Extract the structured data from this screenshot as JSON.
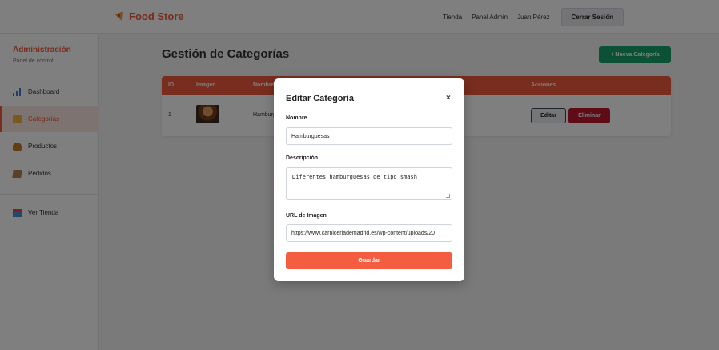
{
  "navbar": {
    "brand": "Food Store",
    "links": [
      "Tienda",
      "Panel Admin",
      "Juan Pérez"
    ],
    "logout_label": "Cerrar Sesión"
  },
  "sidebar": {
    "title": "Administración",
    "subtitle": "Panel de control",
    "items": [
      {
        "label": "Dashboard",
        "icon": "chart-icon"
      },
      {
        "label": "Categorías",
        "icon": "folder-icon",
        "active": true
      },
      {
        "label": "Productos",
        "icon": "burger-icon"
      },
      {
        "label": "Pedidos",
        "icon": "box-icon"
      },
      {
        "label": "Ver Tienda",
        "icon": "store-icon"
      }
    ]
  },
  "main": {
    "title": "Gestión de Categorías",
    "new_button": "+ Nueva Categoría",
    "table": {
      "headers": [
        "ID",
        "Imagen",
        "Nombre",
        "Acciones"
      ],
      "rows": [
        {
          "id": "1",
          "name": "Hamburguesas",
          "edit_label": "Editar",
          "delete_label": "Eliminar"
        }
      ]
    }
  },
  "modal": {
    "title": "Editar Categoría",
    "close": "×",
    "name_label": "Nombre",
    "name_value": "Hamburguesas",
    "desc_label": "Descripción",
    "desc_value": "Diferentes hamburguesas de tipo smash",
    "image_label": "URL de Imagen",
    "image_value": "https://www.carniceriademadrid.es/wp-content/uploads/20",
    "save_label": "Guardar"
  },
  "colors": {
    "accent": "#f15a3b",
    "success": "#15a36d",
    "danger": "#c0192f"
  }
}
